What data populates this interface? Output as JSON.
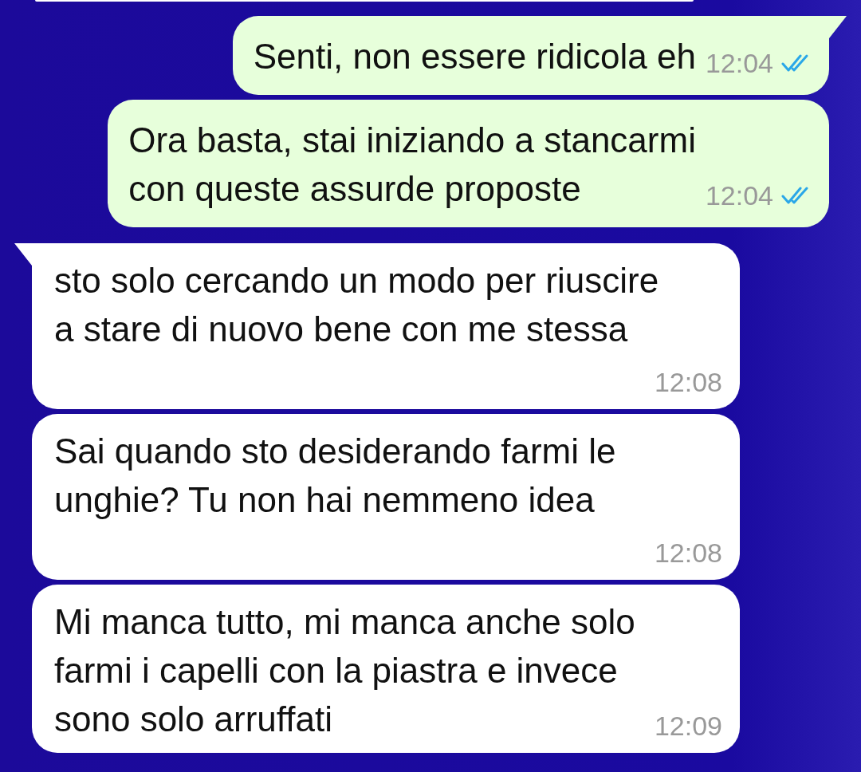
{
  "messages": [
    {
      "kind": "outgoing",
      "text": "Senti, non essere ridicola eh",
      "time": "12:04",
      "read": true,
      "tail": true
    },
    {
      "kind": "outgoing",
      "text": "Ora basta, stai iniziando a stancarmi\ncon queste assurde proposte",
      "time": "12:04",
      "read": true,
      "tail": false
    },
    {
      "kind": "incoming",
      "text": "sto solo cercando un modo per riuscire\na stare di nuovo bene con me stessa",
      "time": "12:08",
      "tail": true
    },
    {
      "kind": "incoming",
      "text": "Sai quando sto desiderando farmi le\nunghie? Tu non hai nemmeno idea",
      "time": "12:08",
      "tail": false
    },
    {
      "kind": "incoming",
      "text": "Mi manca tutto, mi manca anche solo\nfarmi i capelli con la piastra e invece\nsono solo arruffati",
      "time": "12:09",
      "tail": false
    }
  ]
}
